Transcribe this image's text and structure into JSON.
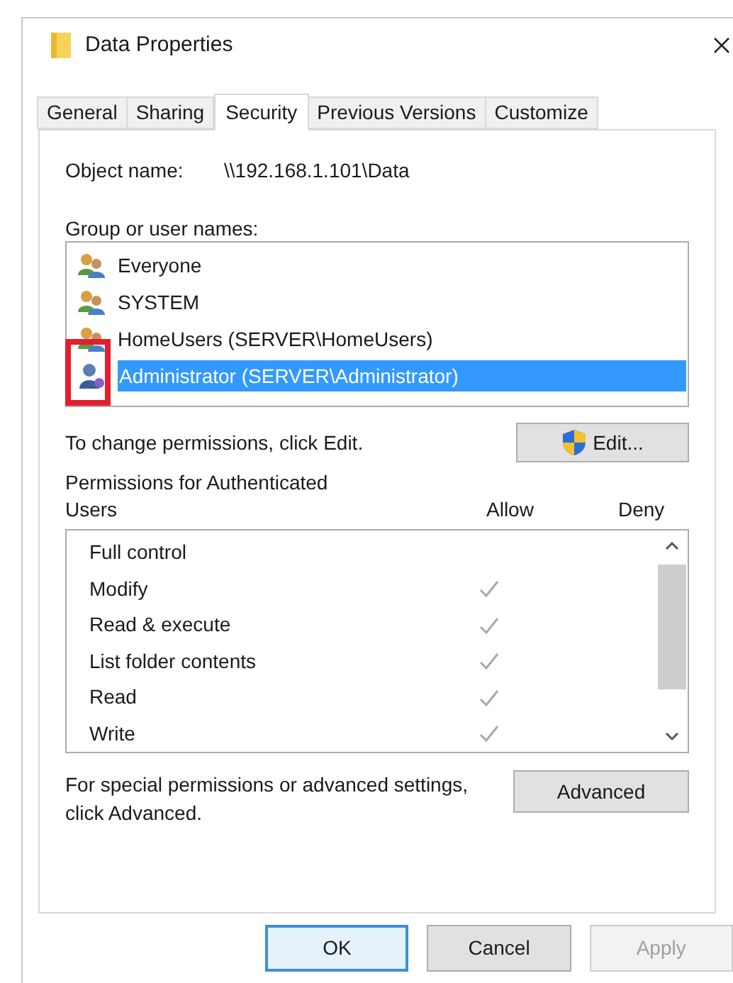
{
  "window": {
    "title": "Data Properties"
  },
  "tabs": [
    {
      "label": "General",
      "selected": false
    },
    {
      "label": "Sharing",
      "selected": false
    },
    {
      "label": "Security",
      "selected": true
    },
    {
      "label": "Previous Versions",
      "selected": false
    },
    {
      "label": "Customize",
      "selected": false
    }
  ],
  "object_name": {
    "label": "Object name:",
    "value": "\\\\192.168.1.101\\Data"
  },
  "group_list": {
    "label": "Group or user names:",
    "items": [
      {
        "name": "Everyone",
        "kind": "group",
        "selected": false
      },
      {
        "name": "SYSTEM",
        "kind": "group",
        "selected": false
      },
      {
        "name": "HomeUsers (SERVER\\HomeUsers)",
        "kind": "group",
        "selected": false
      },
      {
        "name": "Administrator (SERVER\\Administrator)",
        "kind": "user",
        "selected": true
      }
    ]
  },
  "change_hint": "To change permissions, click Edit.",
  "edit_button": "Edit...",
  "permissions": {
    "label": "Permissions for Authenticated Users",
    "allow_header": "Allow",
    "deny_header": "Deny",
    "rows": [
      {
        "name": "Full control",
        "allow": false
      },
      {
        "name": "Modify",
        "allow": true
      },
      {
        "name": "Read & execute",
        "allow": true
      },
      {
        "name": "List folder contents",
        "allow": true
      },
      {
        "name": "Read",
        "allow": true
      },
      {
        "name": "Write",
        "allow": true
      }
    ]
  },
  "advanced_hint": "For special permissions or advanced settings, click Advanced.",
  "advanced_button": "Advanced",
  "buttons": [
    {
      "label": "OK",
      "kind": "default",
      "disabled": false
    },
    {
      "label": "Cancel",
      "kind": "normal",
      "disabled": false
    },
    {
      "label": "Apply",
      "kind": "normal",
      "disabled": true
    }
  ]
}
